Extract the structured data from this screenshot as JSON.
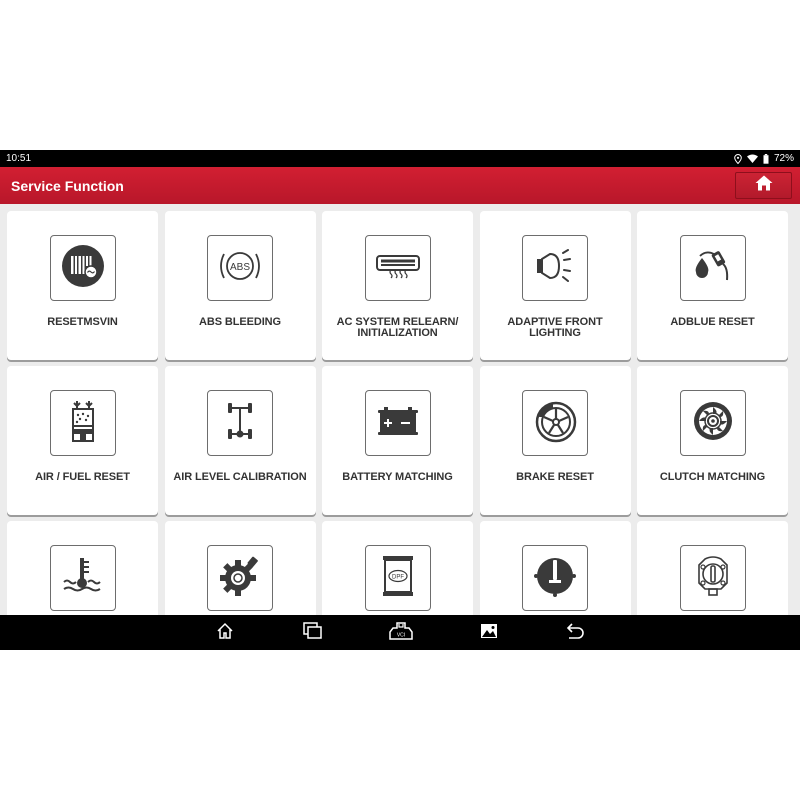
{
  "status_bar": {
    "time": "10:51",
    "battery": "72%",
    "icons": [
      "location-icon",
      "wifi-icon",
      "battery-icon"
    ]
  },
  "header": {
    "title": "Service Function",
    "home_button_icon": "home-icon"
  },
  "colors": {
    "header_red": "#c41b2e",
    "icon_dark": "#3a3a3a",
    "label_text": "#333333",
    "background": "#ececec"
  },
  "functions": [
    {
      "label": "RESETMSVIN",
      "icon": "barcode-vin-icon"
    },
    {
      "label": "ABS BLEEDING",
      "icon": "abs-icon"
    },
    {
      "label": "AC SYSTEM RELEARN/ INITIALIZATION",
      "icon": "air-conditioner-icon"
    },
    {
      "label": "ADAPTIVE FRONT LIGHTING",
      "icon": "headlight-icon"
    },
    {
      "label": "ADBLUE RESET",
      "icon": "fuel-nozzle-drop-icon"
    },
    {
      "label": "AIR / FUEL RESET",
      "icon": "air-fuel-cylinder-icon"
    },
    {
      "label": "AIR LEVEL CALIBRATION",
      "icon": "axle-chassis-icon"
    },
    {
      "label": "BATTERY MATCHING",
      "icon": "battery-icon"
    },
    {
      "label": "BRAKE RESET",
      "icon": "brake-wheel-icon"
    },
    {
      "label": "CLUTCH MATCHING",
      "icon": "clutch-disc-icon"
    },
    {
      "label": "",
      "icon": "coolant-temperature-icon"
    },
    {
      "label": "",
      "icon": "gear-icon"
    },
    {
      "label": "",
      "icon": "dpf-filter-icon"
    },
    {
      "label": "",
      "icon": "throttle-warning-icon"
    },
    {
      "label": "",
      "icon": "fuel-tank-cap-icon"
    }
  ],
  "nav_bar": {
    "buttons": [
      {
        "name": "nav-home-button",
        "icon": "home-outline-icon"
      },
      {
        "name": "nav-recents-button",
        "icon": "recent-apps-icon"
      },
      {
        "name": "nav-vci-button",
        "icon": "vci-connector-icon"
      },
      {
        "name": "nav-screenshot-button",
        "icon": "gallery-icon"
      },
      {
        "name": "nav-back-button",
        "icon": "back-arrow-icon"
      }
    ]
  }
}
